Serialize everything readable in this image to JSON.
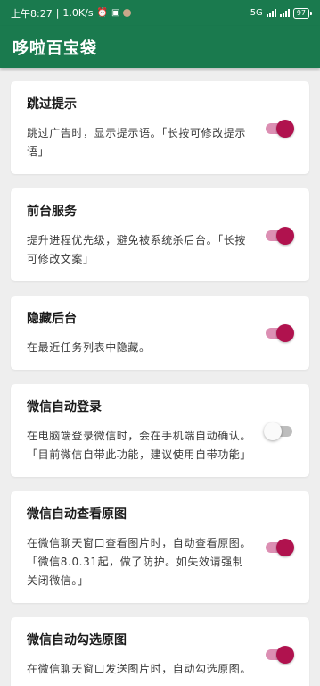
{
  "status_bar": {
    "time": "上午8:27",
    "speed": "1.0K/s",
    "network": "5G",
    "battery": "97"
  },
  "app_bar": {
    "title": "哆啦百宝袋"
  },
  "colors": {
    "primary": "#1a7a4e",
    "switch_on_thumb": "#b0124e",
    "switch_on_track": "#dc8fb3"
  },
  "settings": [
    {
      "title": "跳过提示",
      "desc": "跳过广告时，显示提示语。「长按可修改提示语」",
      "enabled": true
    },
    {
      "title": "前台服务",
      "desc": "提升进程优先级，避免被系统杀后台。「长按可修改文案」",
      "enabled": true
    },
    {
      "title": "隐藏后台",
      "desc": "在最近任务列表中隐藏。",
      "enabled": true
    },
    {
      "title": "微信自动登录",
      "desc": "在电脑端登录微信时，会在手机端自动确认。「目前微信自带此功能，建议使用自带功能」",
      "enabled": false
    },
    {
      "title": "微信自动查看原图",
      "desc": "在微信聊天窗口查看图片时，自动查看原图。「微信8.0.31起，做了防护。如失效请强制关闭微信。」",
      "enabled": true
    },
    {
      "title": "微信自动勾选原图",
      "desc": "在微信聊天窗口发送图片时，自动勾选原图。",
      "enabled": true
    }
  ]
}
